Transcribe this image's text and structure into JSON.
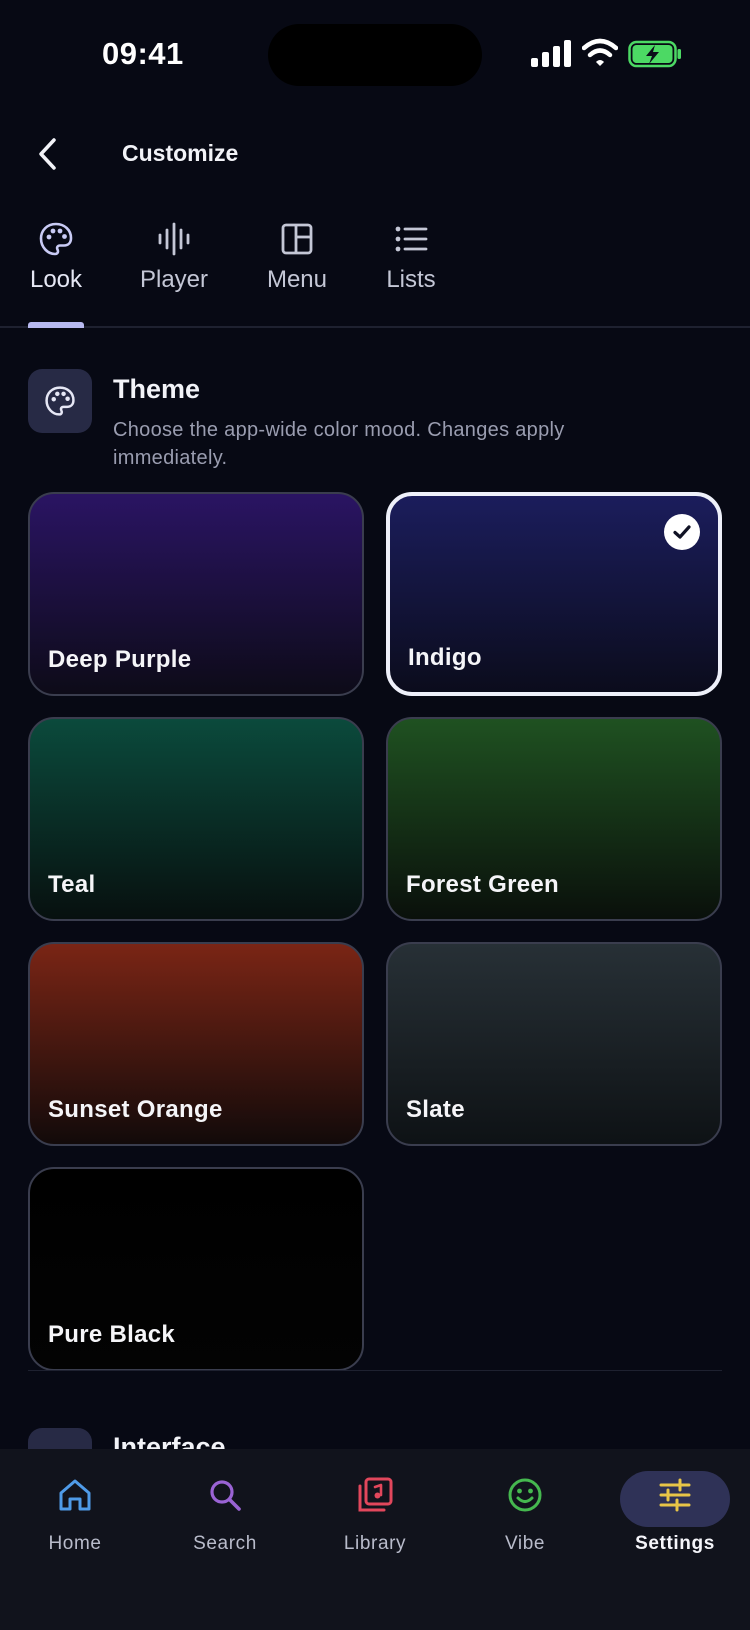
{
  "status_bar": {
    "time": "09:41"
  },
  "header": {
    "title": "Customize"
  },
  "tabs": [
    {
      "label": "Look",
      "icon": "palette-icon",
      "active": true
    },
    {
      "label": "Player",
      "icon": "waveform-icon",
      "active": false
    },
    {
      "label": "Menu",
      "icon": "layout-icon",
      "active": false
    },
    {
      "label": "Lists",
      "icon": "list-icon",
      "active": false
    }
  ],
  "theme_section": {
    "title": "Theme",
    "description": "Choose the app-wide color mood. Changes apply immediately.",
    "selected": "Indigo",
    "themes": [
      {
        "name": "Deep Purple",
        "color_top": "#2a1463",
        "color_bottom": "#0d0b18"
      },
      {
        "name": "Indigo",
        "color_top": "#1b1d5c",
        "color_bottom": "#0b0c1c"
      },
      {
        "name": "Teal",
        "color_top": "#0b4a3c",
        "color_bottom": "#07100f"
      },
      {
        "name": "Forest Green",
        "color_top": "#1f5121",
        "color_bottom": "#0a100b"
      },
      {
        "name": "Sunset Orange",
        "color_top": "#7a2515",
        "color_bottom": "#120a0a"
      },
      {
        "name": "Slate",
        "color_top": "#273036",
        "color_bottom": "#0e1215"
      },
      {
        "name": "Pure Black",
        "color_top": "#000000",
        "color_bottom": "#030303"
      }
    ]
  },
  "next_section": {
    "title": "Interface"
  },
  "bottom_nav": [
    {
      "label": "Home",
      "icon": "home-icon",
      "color": "#4f9be8",
      "active": false
    },
    {
      "label": "Search",
      "icon": "search-icon",
      "color": "#9a63d4",
      "active": false
    },
    {
      "label": "Library",
      "icon": "library-icon",
      "color": "#e2475c",
      "active": false
    },
    {
      "label": "Vibe",
      "icon": "smiley-icon",
      "color": "#45b84f",
      "active": false
    },
    {
      "label": "Settings",
      "icon": "sliders-icon",
      "color": "#e8c547",
      "active": true
    }
  ]
}
